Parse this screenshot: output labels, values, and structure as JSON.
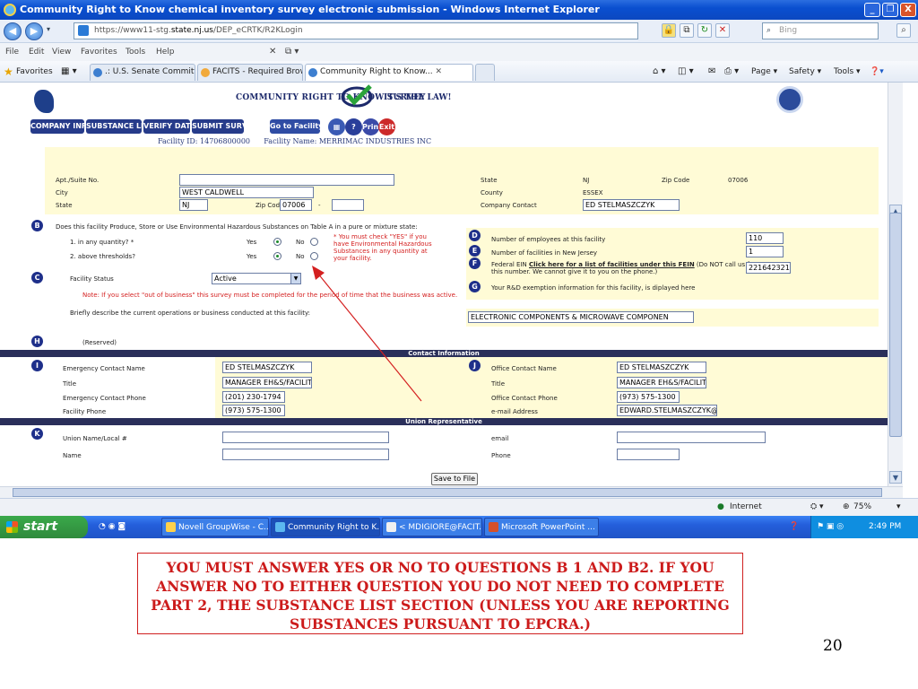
{
  "window": {
    "title": "Community Right to Know chemical inventory survey electronic submission - Windows Internet Explorer",
    "minimize": "_",
    "restore": "❐",
    "close": "X"
  },
  "address": {
    "url_prefix": "https://www11-stg.",
    "url_host": "state.nj.us",
    "url_path": "/DEP_eCRTK/R2KLogin",
    "search_placeholder": "Bing"
  },
  "menu": [
    "File",
    "Edit",
    "View",
    "Favorites",
    "Tools",
    "Help"
  ],
  "favorites": {
    "label": "Favorites",
    "tabs": [
      ".: U.S. Senate Committee on...",
      "FACITS - Required Browser ...",
      "Community Right to Know..."
    ],
    "commands": [
      "Page ▾",
      "Safety ▾",
      "Tools ▾"
    ]
  },
  "site": {
    "title": "COMMUNITY RIGHT TO KNOW SURVEY",
    "slogan": "IT'S THE LAW!",
    "nav": [
      "COMPANY INFO",
      "SUBSTANCE LIST",
      "VERIFY DATA",
      "SUBMIT SURVEY",
      "Go to Facility List"
    ],
    "round_buttons": [
      "Print",
      "Exit"
    ],
    "facility_id_label": "Facility ID:",
    "facility_id": "14706800000",
    "facility_name_label": "Facility Name:",
    "facility_name": "MERRIMAC INDUSTRIES INC"
  },
  "address_section": {
    "apt_label": "Apt./Suite No.",
    "apt_value": "",
    "city_label": "City",
    "city_value": "WEST CALDWELL",
    "state_label": "State",
    "state_value": "NJ",
    "zip_label": "Zip Code",
    "zip_value": "07006",
    "zip_ext": "",
    "right_state_label": "State",
    "right_state_value": "NJ",
    "right_zip_label": "Zip Code",
    "right_zip_value": "07006",
    "county_label": "County",
    "county_value": "ESSEX",
    "company_contact_label": "Company Contact",
    "company_contact_value": "ED STELMASZCZYK"
  },
  "section_b": {
    "letter": "B",
    "question": "Does this facility Produce, Store or Use Environmental Hazardous Substances on Table A in a pure or mixture state:",
    "q1": "1. in any quantity? *",
    "q2": "2. above thresholds?",
    "yes": "Yes",
    "no": "No",
    "note_line1": "* You must check \"YES\" if you",
    "note_line2": "have Environmental Hazardous",
    "note_line3": "Substances in any quantity at",
    "note_line4": "your facility."
  },
  "section_c": {
    "letter": "C",
    "label": "Facility Status",
    "value": "Active",
    "note": "Note: If you select \"out of business\" this survey must be completed for the period of time that the business was active.",
    "describe_label": "Briefly describe the current operations or business conducted at this facility:",
    "describe_value": "ELECTRONIC COMPONENTS & MICROWAVE COMPONEN"
  },
  "section_d": {
    "letter": "D",
    "label": "Number of employees at this facility",
    "value": "110"
  },
  "section_e": {
    "letter": "E",
    "label": "Number of facilities in New Jersey",
    "value": "1"
  },
  "section_f": {
    "letter": "F",
    "label_prefix": "Federal EIN",
    "link": "Click here for a list of facilities under this FEIN",
    "label_suffix": "(Do NOT call us for",
    "label_line2": "this number. We cannot give it to you on the phone.)",
    "value": "221642321"
  },
  "section_g": {
    "letter": "G",
    "label": "Your R&D exemption information for this facility, is diplayed here"
  },
  "section_h": {
    "letter": "H",
    "label": "(Reserved)"
  },
  "contact": {
    "header": "Contact Information",
    "letter_i": "I",
    "letter_j": "J",
    "emergency_name_label": "Emergency Contact Name",
    "emergency_name": "ED STELMASZCZYK",
    "title_label": "Title",
    "title_value": "MANAGER EH&S/FACILITI",
    "emergency_phone_label": "Emergency Contact Phone",
    "emergency_phone": "(201) 230-1794",
    "facility_phone_label": "Facility Phone",
    "facility_phone": "(973) 575-1300",
    "office_name_label": "Office Contact Name",
    "office_name": "ED STELMASZCZYK",
    "office_title_label": "Title",
    "office_title": "MANAGER EH&S/FACILIT",
    "office_phone_label": "Office Contact Phone",
    "office_phone": "(973) 575-1300",
    "email_label": "e-mail Address",
    "email_value": "EDWARD.STELMASZCZYK@"
  },
  "union": {
    "header": "Union Representative",
    "letter": "K",
    "name_local_label": "Union Name/Local #",
    "name_label": "Name",
    "email_label": "email",
    "phone_label": "Phone"
  },
  "save_button": "Save to File",
  "status": {
    "zone": "Internet",
    "zoom": "75%"
  },
  "taskbar": {
    "start": "start",
    "tasks": [
      "Novell GroupWise - C...",
      "Community Right to K...",
      "< MDIGIORE@FACIT...",
      "Microsoft PowerPoint ..."
    ],
    "clock": "2:49 PM"
  },
  "caption": "YOU MUST ANSWER YES OR NO TO QUESTIONS B 1 AND B2.  IF YOU ANSWER NO TO EITHER QUESTION YOU DO NOT NEED TO COMPLETE PART 2, THE SUBSTANCE LIST SECTION (UNLESS YOU ARE REPORTING SUBSTANCES PURSUANT TO EPCRA.)",
  "slide_number": "20",
  "colors": {
    "accent": "#263b8a",
    "warning": "#d42020",
    "field_band": "#fffbd6",
    "caption": "#cc1b1b"
  }
}
